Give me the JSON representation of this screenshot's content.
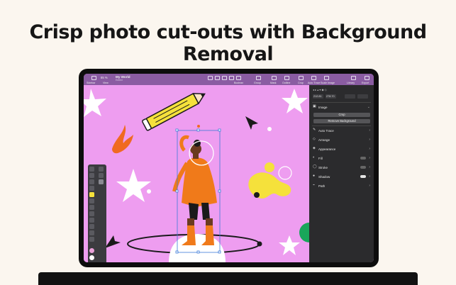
{
  "headline": "Crisp photo cut-outs with Background Removal",
  "colors": {
    "page_bg": "#fbf6ef",
    "canvas_bg": "#ee9df0",
    "toolbar_bg": "#8a5ca2",
    "inspector_bg": "#2b2b2d",
    "accent_yellow": "#f5e13b",
    "accent_orange": "#f06a21"
  },
  "toolbar": {
    "zoom": "85 %",
    "doc_title": "My World",
    "doc_subtitle": "Edited",
    "labels": [
      "Sidebar",
      "View",
      "Boolean",
      "Group",
      "Mask",
      "Outline",
      "Crop",
      "Auto Trace",
      "Scale Image",
      "Library",
      "Export"
    ]
  },
  "inspector": {
    "image_section": "Image",
    "crop_button": "Crop",
    "remove_bg_button": "Remove Background",
    "fields": [
      "212.81",
      "278.70"
    ],
    "rows": [
      {
        "label": "Auto Trace",
        "icon": "auto-trace-icon"
      },
      {
        "label": "Arrange",
        "icon": "arrange-icon"
      },
      {
        "label": "Appearance",
        "icon": "appearance-icon"
      },
      {
        "label": "Fill",
        "icon": "fill-icon",
        "toggle": false
      },
      {
        "label": "Stroke",
        "icon": "stroke-icon",
        "toggle": false
      },
      {
        "label": "Shadow",
        "icon": "shadow-icon",
        "toggle": true
      },
      {
        "label": "Path",
        "icon": "path-icon"
      }
    ]
  }
}
